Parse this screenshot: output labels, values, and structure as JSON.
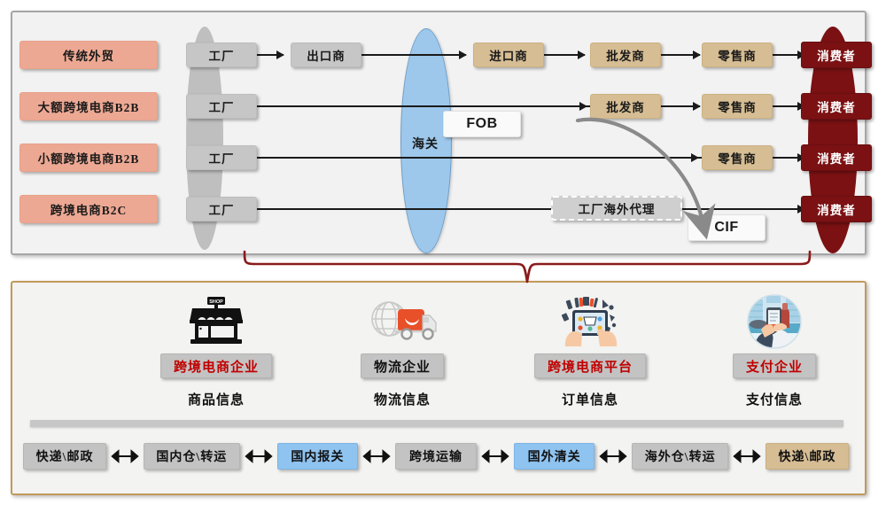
{
  "top_section": {
    "rows": [
      {
        "mode": "传统外贸",
        "nodes": [
          "工厂",
          "出口商",
          "进口商",
          "批发商",
          "零售商",
          "消费者"
        ]
      },
      {
        "mode": "大额跨境电商B2B",
        "nodes": [
          "工厂",
          "批发商",
          "零售商",
          "消费者"
        ]
      },
      {
        "mode": "小额跨境电商B2B",
        "nodes": [
          "工厂",
          "零售商",
          "消费者"
        ]
      },
      {
        "mode": "跨境电商B2C",
        "nodes": [
          "工厂",
          "工厂海外代理",
          "消费者"
        ]
      }
    ],
    "customs_label": "海关",
    "terms": {
      "fob": "FOB",
      "cif": "CIF"
    }
  },
  "bottom_section": {
    "entities": [
      {
        "icon": "shop-icon",
        "label": "跨境电商企业",
        "label_color": "#c00000",
        "caption": "商品信息"
      },
      {
        "icon": "logistics-icon",
        "label": "物流企业",
        "label_color": "#111111",
        "caption": "物流信息"
      },
      {
        "icon": "tablet-icon",
        "label": "跨境电商平台",
        "label_color": "#c00000",
        "caption": "订单信息"
      },
      {
        "icon": "payment-icon",
        "label": "支付企业",
        "label_color": "#c00000",
        "caption": "支付信息"
      }
    ],
    "chain": [
      {
        "label": "快递\\邮政",
        "style": "gray"
      },
      {
        "label": "国内仓\\转运",
        "style": "gray"
      },
      {
        "label": "国内报关",
        "style": "blue"
      },
      {
        "label": "跨境运输",
        "style": "gray"
      },
      {
        "label": "国外清关",
        "style": "blue"
      },
      {
        "label": "海外仓\\转运",
        "style": "gray"
      },
      {
        "label": "快递\\邮政",
        "style": "tan"
      }
    ]
  },
  "colors": {
    "mode_box": "#eda893",
    "factory_box": "#c6c6c6",
    "trader_box": "#d6bd93",
    "consumer_box": "#7b1113",
    "customs_ellipse": "#9dc8ec",
    "bottom_border": "#c19a5b",
    "accent_red": "#c00000",
    "brace": "#8b1a1a",
    "highlight_blue": "#8fc3f0"
  }
}
